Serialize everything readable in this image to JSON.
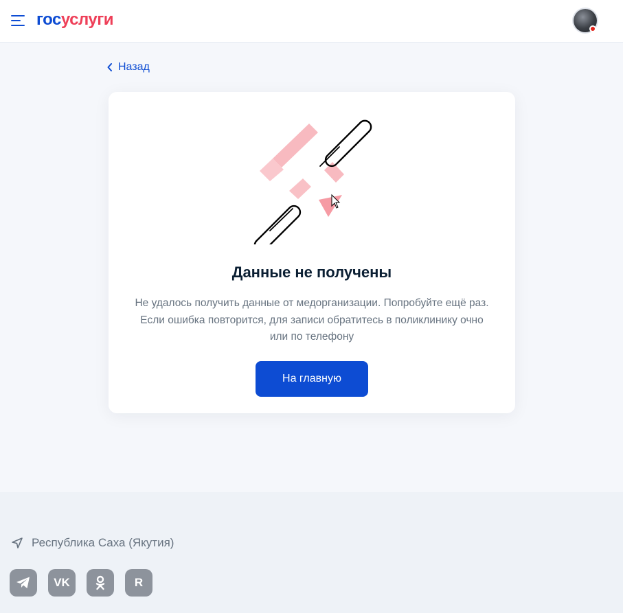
{
  "header": {
    "logo_part1": "гос",
    "logo_part2": "услуги",
    "menu_icon": "hamburger-menu-icon",
    "avatar_icon": "user-avatar",
    "notification_color": "#e2231a"
  },
  "nav": {
    "back_label": "Назад",
    "back_icon": "chevron-left-icon"
  },
  "error_card": {
    "illustration": "broken-chain-icon",
    "title": "Данные не получены",
    "description_lines": [
      "Не удалось получить данные от медорганизации. Попробуйте ещё раз.",
      "Если ошибка повторится, для записи обратитесь в поликлинику очно",
      "или по телефону"
    ],
    "button_label": "На главную"
  },
  "footer": {
    "region": "Республика Саха (Якутия)",
    "region_icon": "location-arrow-icon",
    "socials": [
      {
        "name": "telegram",
        "icon": "telegram-icon"
      },
      {
        "name": "vk",
        "icon": "vk-icon",
        "glyph": "VK"
      },
      {
        "name": "odnoklassniki",
        "icon": "odnoklassniki-icon"
      },
      {
        "name": "rutube",
        "icon": "rutube-icon",
        "glyph": "R"
      }
    ]
  },
  "colors": {
    "primary": "#0d4cd3",
    "accent_red": "#ee3f58",
    "background": "#f5f7fb",
    "footer_bg": "#eef2f7",
    "text_secondary": "#66727f"
  }
}
